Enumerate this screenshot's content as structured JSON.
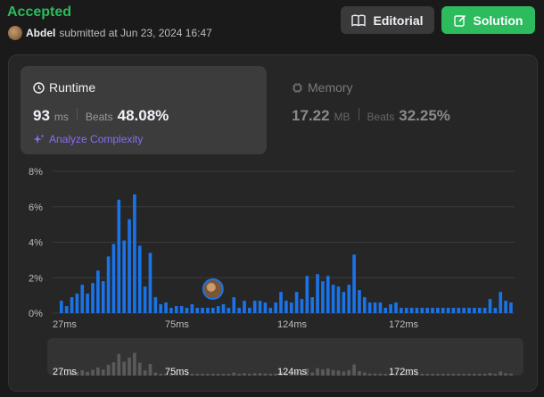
{
  "header": {
    "status": "Accepted",
    "username": "Abdel",
    "submitted_text": "submitted at Jun 23, 2024 16:47",
    "editorial_label": "Editorial",
    "solution_label": "Solution"
  },
  "runtime": {
    "label": "Runtime",
    "value": "93",
    "unit": "ms",
    "beats_label": "Beats",
    "beats_pct": "48.08%",
    "analyze_label": "Analyze Complexity"
  },
  "memory": {
    "label": "Memory",
    "value": "17.22",
    "unit": "MB",
    "beats_label": "Beats",
    "beats_pct": "32.25%"
  },
  "colors": {
    "accepted": "#2cbb5d",
    "bar": "#1a73e8",
    "bar_dim": "#5a5a5a",
    "analyze": "#8a6cf6"
  },
  "chart_data": {
    "type": "bar",
    "ylabels": [
      "8%",
      "6%",
      "4%",
      "2%",
      "0%"
    ],
    "ylim": [
      0,
      8
    ],
    "xlabels": [
      "27ms",
      "75ms",
      "124ms",
      "172ms"
    ],
    "values": [
      0.7,
      0.4,
      0.9,
      1.1,
      1.6,
      1.1,
      1.7,
      2.4,
      1.8,
      3.2,
      3.9,
      6.4,
      4.1,
      5.3,
      6.7,
      3.8,
      1.5,
      3.4,
      0.9,
      0.5,
      0.6,
      0.3,
      0.4,
      0.4,
      0.3,
      0.5,
      0.3,
      0.3,
      0.3,
      0.3,
      0.4,
      0.5,
      0.3,
      0.9,
      0.3,
      0.7,
      0.3,
      0.7,
      0.7,
      0.6,
      0.3,
      0.6,
      1.2,
      0.7,
      0.6,
      1.2,
      0.8,
      2.1,
      0.9,
      2.2,
      1.8,
      2.1,
      1.6,
      1.5,
      1.2,
      1.6,
      3.3,
      1.3,
      0.9,
      0.6,
      0.6,
      0.6,
      0.3,
      0.5,
      0.6,
      0.3,
      0.3,
      0.3,
      0.3,
      0.3,
      0.3,
      0.3,
      0.3,
      0.3,
      0.3,
      0.3,
      0.3,
      0.3,
      0.3,
      0.3,
      0.3,
      0.3,
      0.8,
      0.3,
      1.2,
      0.7,
      0.6
    ],
    "highlight_index": 29,
    "overview_xlabels": [
      "27ms",
      "75ms",
      "124ms",
      "172ms"
    ]
  }
}
